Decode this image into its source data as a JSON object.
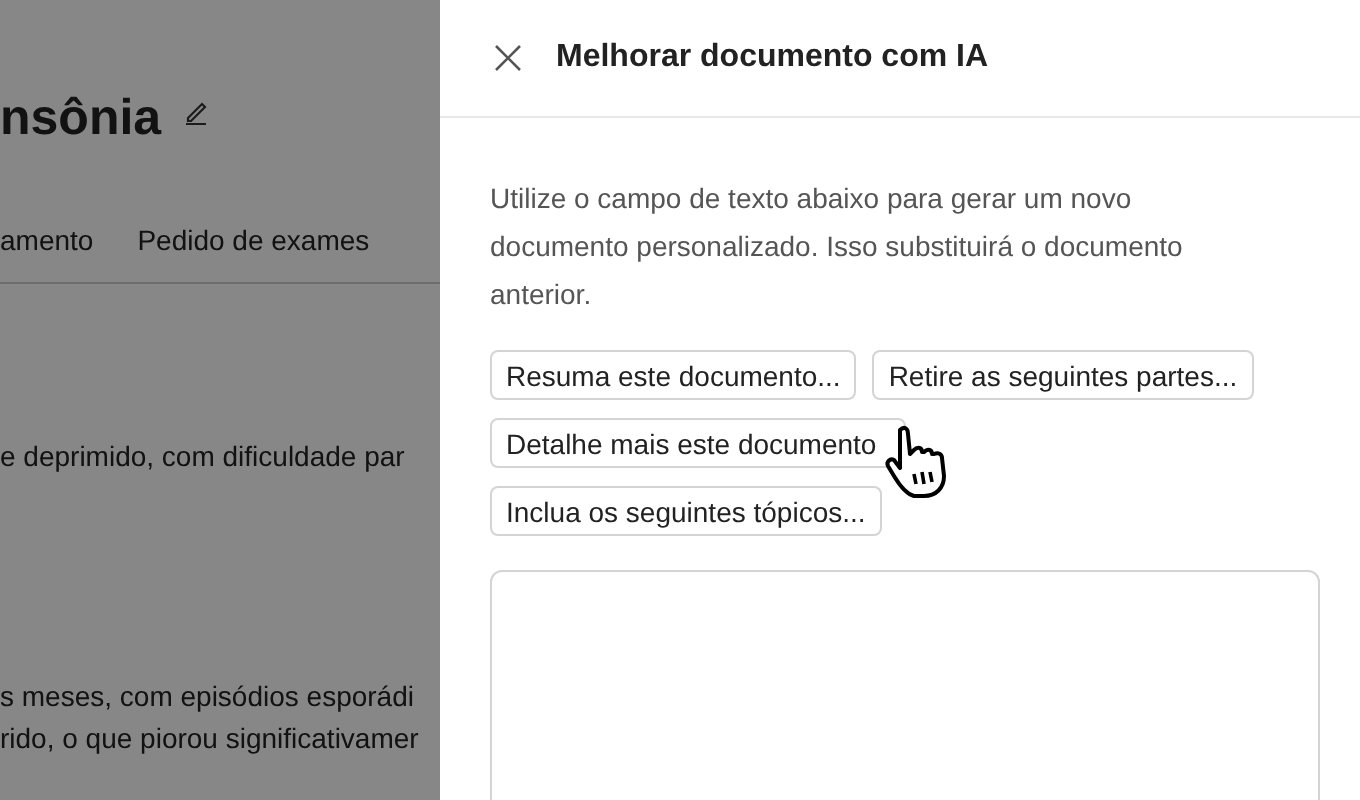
{
  "background_page": {
    "title": "nsônia",
    "tabs": [
      {
        "label": "amento",
        "selected": false
      },
      {
        "label": "Pedido de exames",
        "selected": false
      }
    ],
    "lines": [
      "e deprimido, com dificuldade par",
      "s meses, com episódios esporádi",
      "rido, o que piorou significativamer"
    ]
  },
  "panel": {
    "title": "Melhorar documento com IA",
    "description": "Utilize o campo de texto abaixo para gerar um novo documento personalizado. Isso substituirá o documento anterior.",
    "suggestions": [
      "Resuma este documento...",
      "Retire as seguintes partes...",
      "Detalhe mais este documento",
      "Inclua os seguintes tópicos..."
    ]
  }
}
